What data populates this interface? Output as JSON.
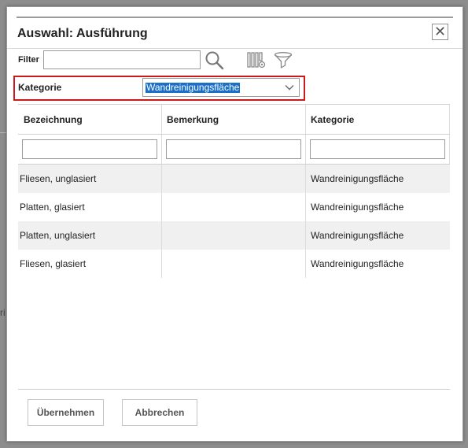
{
  "background": {
    "fragment_text": "ri"
  },
  "dialog": {
    "title": "Auswahl: Ausführung",
    "close_glyph": "✕",
    "close_icon": "close-icon"
  },
  "filter": {
    "label": "Filter",
    "value": "",
    "icons": [
      "search-icon",
      "column-chooser-icon",
      "funnel-icon"
    ]
  },
  "kategorie": {
    "label": "Kategorie",
    "selected": "Wandreinigungsfläche",
    "highlight_color": "#cc1a1a"
  },
  "table": {
    "columns": [
      "Bezeichnung",
      "Bemerkung",
      "Kategorie"
    ],
    "rows": [
      {
        "bezeichnung": "Fliesen, unglasiert",
        "bemerkung": "",
        "kategorie": "Wandreinigungsfläche"
      },
      {
        "bezeichnung": "Platten, glasiert",
        "bemerkung": "",
        "kategorie": "Wandreinigungsfläche"
      },
      {
        "bezeichnung": "Platten, unglasiert",
        "bemerkung": "",
        "kategorie": "Wandreinigungsfläche"
      },
      {
        "bezeichnung": "Fliesen, glasiert",
        "bemerkung": "",
        "kategorie": "Wandreinigungsfläche"
      }
    ]
  },
  "footer": {
    "apply_label": "Übernehmen",
    "cancel_label": "Abbrechen"
  }
}
